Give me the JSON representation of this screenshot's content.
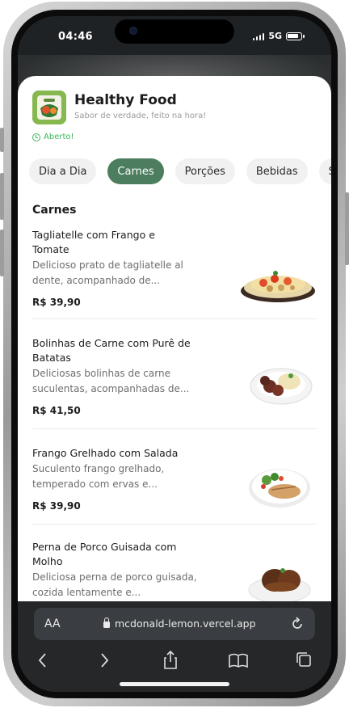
{
  "status_bar": {
    "time": "04:46",
    "network": "5G"
  },
  "restaurant": {
    "name": "Healthy Food",
    "tagline": "Sabor de verdade, feito na hora!",
    "status": "Aberto!"
  },
  "categories": [
    {
      "label": "Dia a Dia",
      "active": false
    },
    {
      "label": "Carnes",
      "active": true
    },
    {
      "label": "Porções",
      "active": false
    },
    {
      "label": "Bebidas",
      "active": false
    },
    {
      "label": "So",
      "active": false
    }
  ],
  "section_title": "Carnes",
  "products": [
    {
      "name": "Tagliatelle com Frango e Tomate",
      "description": "Delicioso prato de tagliatelle al dente, acompanhado de...",
      "price": "R$ 39,90"
    },
    {
      "name": "Bolinhas de Carne com Purê de Batatas",
      "description": "Deliciosas bolinhas de carne suculentas, acompanhadas de...",
      "price": "R$ 41,50"
    },
    {
      "name": "Frango Grelhado com Salada",
      "description": "Suculento frango grelhado, temperado com ervas e...",
      "price": "R$ 39,90"
    },
    {
      "name": "Perna de Porco Guisada com Molho",
      "description": "Deliciosa perna de porco guisada, cozida lentamente e...",
      "price": ""
    }
  ],
  "browser": {
    "text_size_label": "AA",
    "url": "mcdonald-lemon.vercel.app"
  },
  "colors": {
    "accent": "#4b7d5e",
    "open_status": "#3cb55a"
  }
}
